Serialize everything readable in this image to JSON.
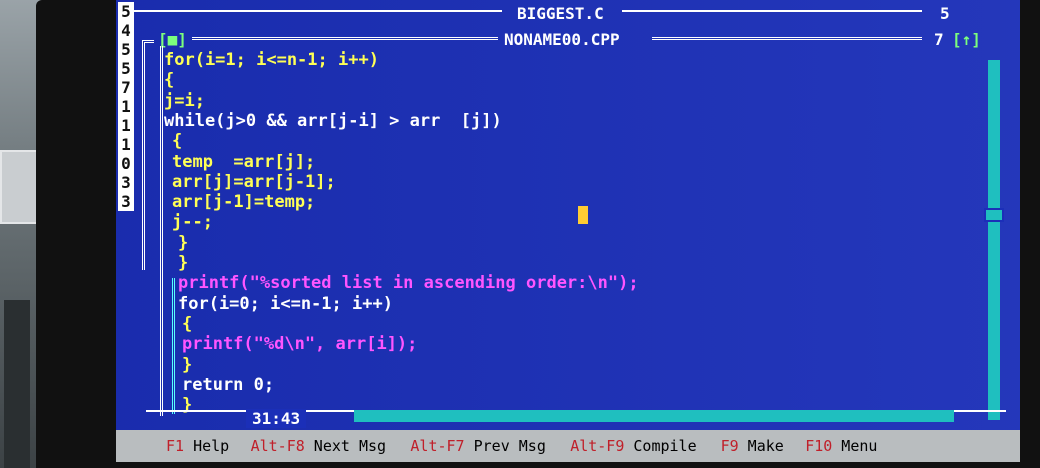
{
  "windows": {
    "back": {
      "title": "BIGGEST.C",
      "number": "5"
    },
    "front": {
      "title": "NONAME00.CPP",
      "number": "7",
      "close_box": "[■]",
      "zoom_box": "[↑]"
    }
  },
  "gutter_digits": [
    "5",
    "4",
    "5",
    "5",
    "7",
    "1",
    "1",
    "1",
    "0",
    "3",
    "3"
  ],
  "code_lines": [
    {
      "text": "for(i=1; i<=n-1; i++)",
      "color": "y"
    },
    {
      "text": "{",
      "color": "y"
    },
    {
      "text": "j=i;",
      "color": "y"
    },
    {
      "text": "while(j>0 && arr[j-i] > arr  [j])",
      "color": "w"
    },
    {
      "text": "{",
      "color": "y"
    },
    {
      "text": "temp  =arr[j];",
      "color": "y"
    },
    {
      "text": "arr[j]=arr[j-1];",
      "color": "y"
    },
    {
      "text": "arr[j-1]=temp;",
      "color": "y"
    },
    {
      "text": "j--;",
      "color": "y"
    },
    {
      "text": "}",
      "color": "y"
    },
    {
      "text": "}",
      "color": "y"
    },
    {
      "text": "printf(\"%sorted list in ascending order:\\n\");",
      "color": "p"
    },
    {
      "text": "for(i=0; i<=n-1; i++)",
      "color": "w"
    },
    {
      "text": "{",
      "color": "y"
    },
    {
      "text": "printf(\"%d\\n\", arr[i]);",
      "color": "p"
    },
    {
      "text": "}",
      "color": "y"
    },
    {
      "text": "return 0;",
      "color": "w"
    },
    {
      "text": "}",
      "color": "y"
    }
  ],
  "cursor_position": "31:43",
  "status_bar": [
    {
      "key": "F1",
      "label": "Help"
    },
    {
      "key": "Alt-F8",
      "label": "Next Msg"
    },
    {
      "key": "Alt-F7",
      "label": "Prev Msg"
    },
    {
      "key": "Alt-F9",
      "label": "Compile"
    },
    {
      "key": "F9",
      "label": "Make"
    },
    {
      "key": "F10",
      "label": "Menu"
    }
  ],
  "colors": {
    "editor_background": "#1b2fb8",
    "keyword_yellow": "#ffff55",
    "string_magenta": "#ff55ff",
    "frame_white": "#ffffff",
    "scrollbar_cyan": "#1fbfbf",
    "status_bar_gray": "#b9bdbf",
    "hotkey_red": "#c0202a"
  }
}
